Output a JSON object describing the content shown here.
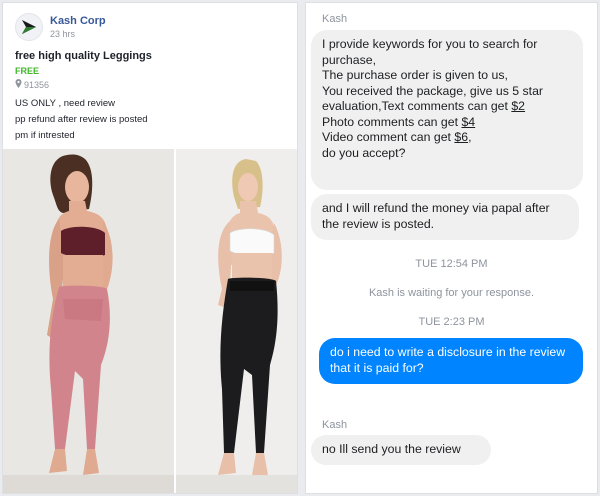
{
  "post": {
    "company": "Kash Corp",
    "time": "23 hrs",
    "title": "free high quality Leggings",
    "price": "FREE",
    "location": "91356",
    "desc_lines": [
      "US ONLY , need review",
      "pp refund after review is posted",
      "pm if intrested"
    ],
    "logo_icon": "arrow-logo-icon",
    "location_icon": "pin-icon"
  },
  "chat": {
    "sender1": "Kash",
    "message1": {
      "pre": "I provide keywords for you to search for purchase,\nThe purchase order is given to us,\nYou received the package, give us 5 star evaluation,Text comments can get ",
      "amt1": "$2",
      "mid1": "\nPhoto comments can get ",
      "amt2": "$4",
      "mid2": "\nVideo comment can get ",
      "amt3": "$6",
      "post": ",\ndo you accept?"
    },
    "message2": "and I will refund the money via papal after the review is posted.",
    "time1": "TUE 12:54 PM",
    "waiting": "Kash is waiting for your response.",
    "time2": "TUE 2:23 PM",
    "reply": "do i need to write a disclosure in the review that it is paid for?",
    "sender2": "Kash",
    "message3": "no Ill send you the review"
  },
  "colors": {
    "accent": "#0084ff",
    "link": "#385898",
    "free": "#42b72a"
  }
}
